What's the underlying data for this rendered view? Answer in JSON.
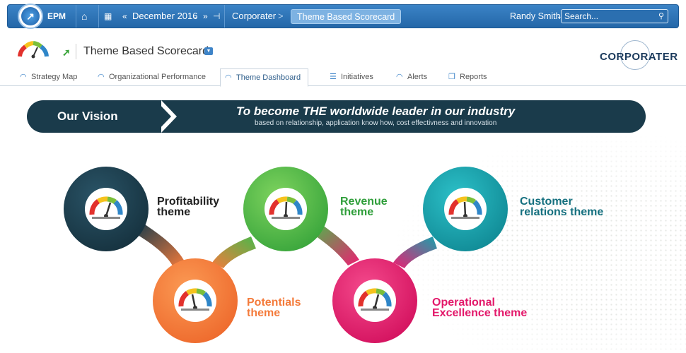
{
  "topbar": {
    "app": "EPM",
    "period": "December 2016",
    "breadcrumb_parent": "Corporater",
    "breadcrumb_current": "Theme Based Scorecard",
    "user": "Randy Smith",
    "search_placeholder": "Search..."
  },
  "header": {
    "title": "Theme Based Scorecard",
    "brand": "CORPORATER"
  },
  "tabs": [
    {
      "label": "Strategy Map",
      "icon": "gauge-icon"
    },
    {
      "label": "Organizational Performance",
      "icon": "gauge-icon"
    },
    {
      "label": "Theme Dashboard",
      "icon": "gauge-icon",
      "active": true
    },
    {
      "label": "Initiatives",
      "icon": "list-icon"
    },
    {
      "label": "Alerts",
      "icon": "gauge-icon"
    },
    {
      "label": "Reports",
      "icon": "reports-icon"
    }
  ],
  "vision": {
    "tag": "Our Vision",
    "statement": "To become THE worldwide leader in our industry",
    "subtitle": "based on relationship,  application know how, cost effectivness and innovation"
  },
  "themes": [
    {
      "line1": "Profitability",
      "line2": "theme",
      "color": "#1a3b4b",
      "label_color": "#222222"
    },
    {
      "line1": "Revenue",
      "line2": "theme",
      "color": "#4cb84a",
      "label_color": "#2f9e3a"
    },
    {
      "line1": "Customer",
      "line2": "relations theme",
      "color": "#17a2ad",
      "label_color": "#15707f"
    },
    {
      "line1": "Potentials",
      "line2": "theme",
      "color": "#f47b3b",
      "label_color": "#f47b3b"
    },
    {
      "line1": "Operational",
      "line2": "Excellence theme",
      "color": "#ec1f72",
      "label_color": "#e3186a"
    }
  ]
}
